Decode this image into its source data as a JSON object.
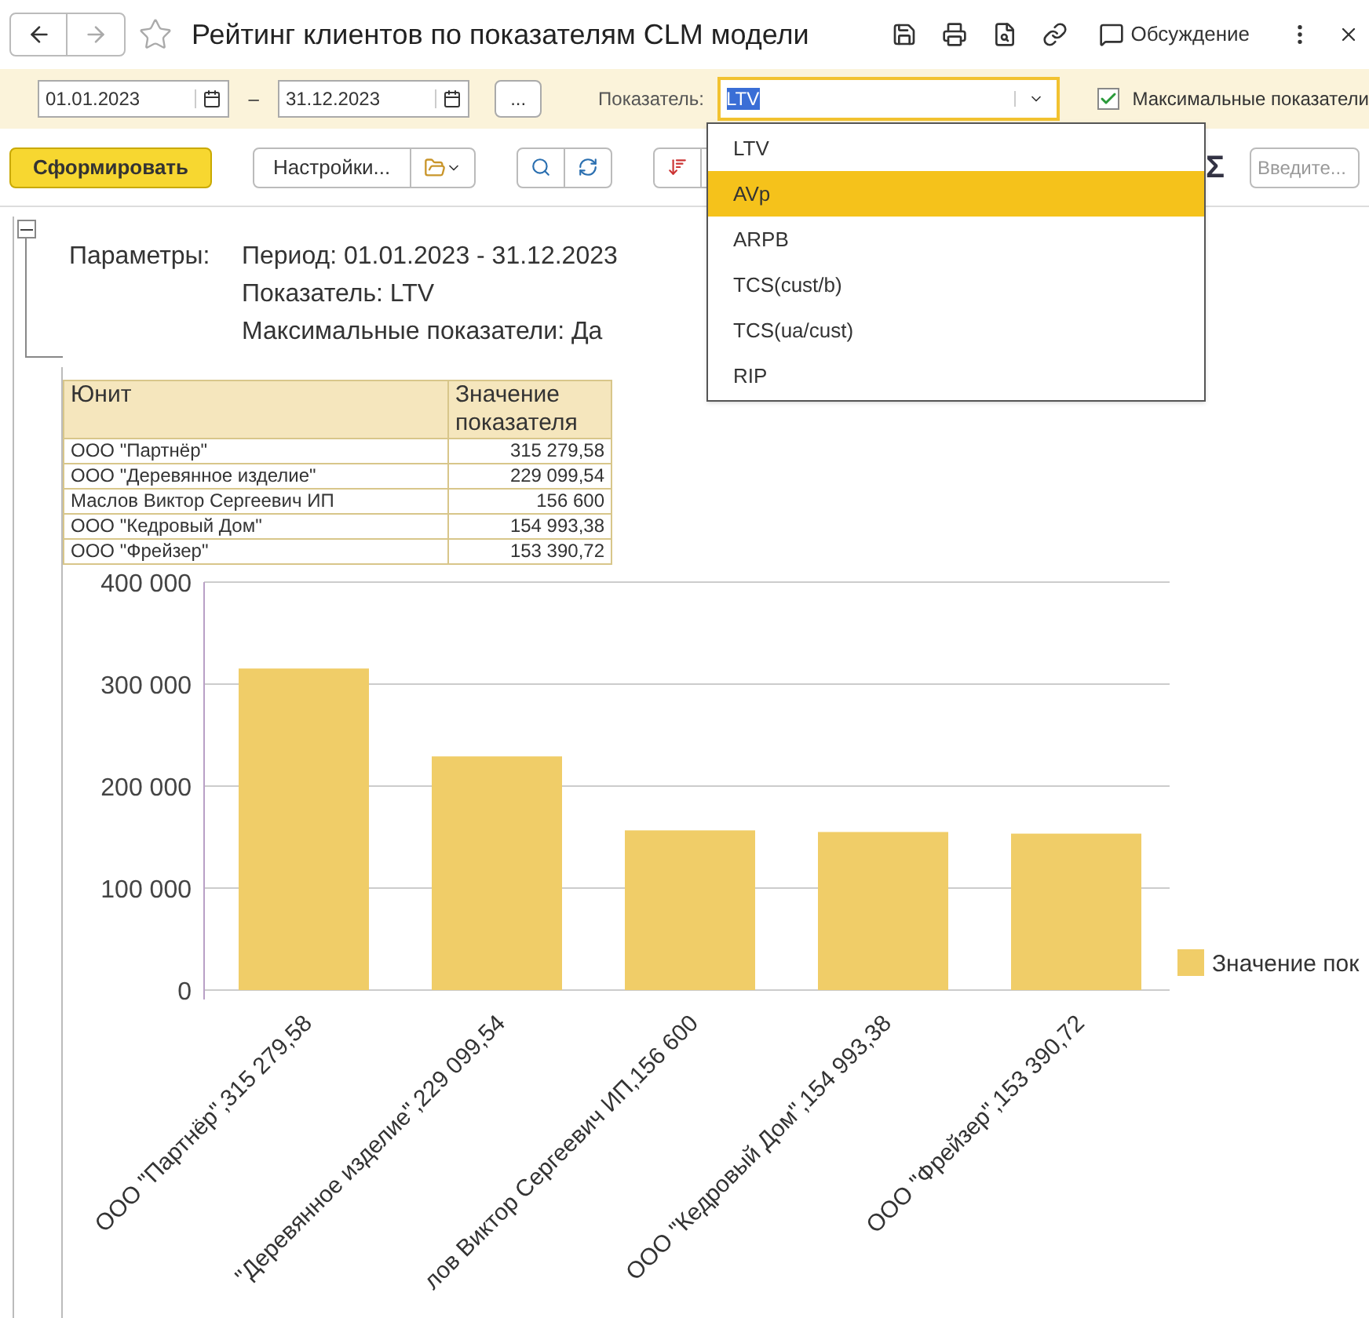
{
  "window": {
    "title": "Рейтинг клиентов по показателям CLM модели",
    "discussion": "Обсуждение"
  },
  "filters": {
    "date_from": "01.01.2023",
    "dash": "–",
    "date_to": "31.12.2023",
    "period_button": "...",
    "indicator_label": "Показатель:",
    "indicator_value": "LTV",
    "max_checkbox": {
      "label": "Максимальные показатели",
      "checked": true
    }
  },
  "dropdown": [
    {
      "label": "LTV",
      "selected": false
    },
    {
      "label": "AVp",
      "selected": true
    },
    {
      "label": "ARPB",
      "selected": false
    },
    {
      "label": "TCS(cust/b)",
      "selected": false
    },
    {
      "label": "TCS(ua/cust)",
      "selected": false
    },
    {
      "label": "RIP",
      "selected": false
    }
  ],
  "toolbar": {
    "generate": "Сформировать",
    "settings": "Настройки...",
    "sigma": "Σ",
    "search_placeholder": "Введите..."
  },
  "report": {
    "params_label": "Параметры:",
    "params": [
      "Период: 01.01.2023 - 31.12.2023",
      "Показатель: LTV",
      "Максимальные показатели: Да"
    ],
    "table": {
      "columns": [
        "Юнит",
        "Значение показателя"
      ],
      "rows": [
        [
          "ООО \"Партнёр\"",
          "315 279,58"
        ],
        [
          "ООО \"Деревянное изделие\"",
          "229 099,54"
        ],
        [
          "Маслов Виктор Сергеевич ИП",
          "156 600"
        ],
        [
          "ООО \"Кедровый Дом\"",
          "154 993,38"
        ],
        [
          "ООО \"Фрейзер\"",
          "153 390,72"
        ]
      ]
    },
    "chart_data": {
      "type": "bar",
      "categories": [
        "ООО \"Партнёр\",315 279,58",
        "\"Деревянное изделие\",229 099,54",
        "лов Виктор Сергеевич ИП,156 600",
        "ООО \"Кедровый Дом\",154 993,38",
        "ООО \"Фрейзер\",153 390,72"
      ],
      "series": [
        {
          "name": "Значение пок",
          "color": "#f0cd68",
          "values": [
            315279.58,
            229099.54,
            156600,
            154993.38,
            153390.72
          ]
        }
      ],
      "ylim": [
        0,
        400000
      ],
      "grid": true,
      "yticks": [
        {
          "value": 0,
          "label": "0"
        },
        {
          "value": 100000,
          "label": "100 000"
        },
        {
          "value": 200000,
          "label": "200 000"
        },
        {
          "value": 300000,
          "label": "300 000"
        },
        {
          "value": 400000,
          "label": "400 000"
        }
      ]
    }
  }
}
